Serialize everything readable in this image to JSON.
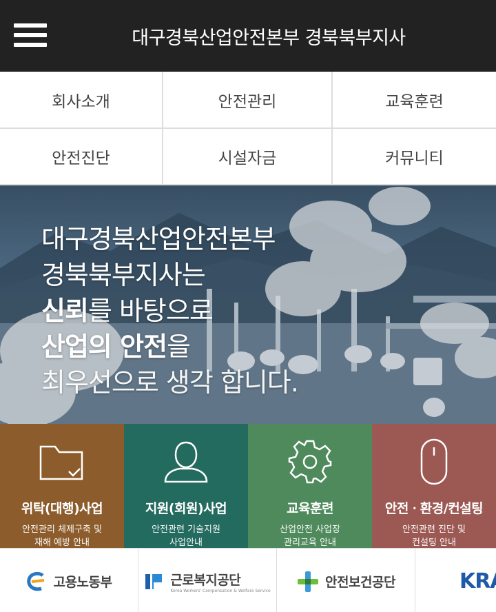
{
  "header": {
    "title": "대구경북산업안전본부 경북북부지사"
  },
  "nav": [
    {
      "label": "회사소개"
    },
    {
      "label": "안전관리"
    },
    {
      "label": "교육훈련"
    },
    {
      "label": "안전진단"
    },
    {
      "label": "시설자금"
    },
    {
      "label": "커뮤니티"
    }
  ],
  "hero": {
    "line1": "대구경북산업안전본부",
    "line2": "경북북부지사는",
    "line3_strong": "신뢰",
    "line3_rest": "를 바탕으로",
    "line4_strong": "산업의 안전",
    "line4_rest": "을",
    "line5": "최우선으로 생각 합니다."
  },
  "services": [
    {
      "title": "위탁(대행)사업",
      "desc1": "안전관리 체제구축 및",
      "desc2": "재해 예방 안내",
      "icon": "folder-check-icon",
      "color": "#8d5c2c"
    },
    {
      "title": "지원(회원)사업",
      "desc1": "안전관련 기술지원",
      "desc2": "사업안내",
      "icon": "person-icon",
      "color": "#236a5f"
    },
    {
      "title": "교육훈련",
      "desc1": "산업안전 사업장",
      "desc2": "관리교육 안내",
      "icon": "gear-icon",
      "color": "#4f8a5c"
    },
    {
      "title": "안전ㆍ환경/컨설팅",
      "desc1": "안전관련 진단 및",
      "desc2": "컨설팅 안내",
      "icon": "mouse-icon",
      "color": "#9c5953"
    }
  ],
  "partners": [
    {
      "name": "고용노동부",
      "icon": "moel-logo"
    },
    {
      "name": "근로복지공단",
      "sub": "Korea Workers' Compensation & Welfare Service",
      "icon": "comwel-logo"
    },
    {
      "name": "안전보건공단",
      "icon": "kosha-logo"
    },
    {
      "name": "KRA",
      "icon": "kra-logo"
    }
  ]
}
